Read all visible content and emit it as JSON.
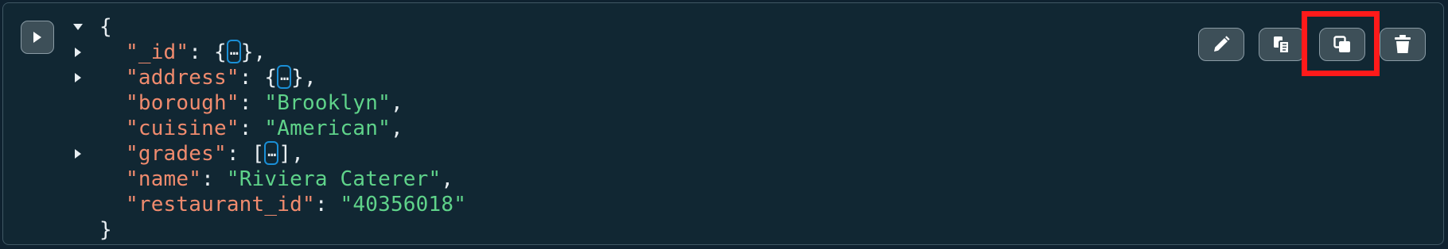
{
  "document": {
    "open_brace": "{",
    "close_brace": "}",
    "ellipsis": "…",
    "fields": [
      {
        "key": "\"_id\"",
        "type": "object"
      },
      {
        "key": "\"address\"",
        "type": "object"
      },
      {
        "key": "\"borough\"",
        "type": "string",
        "value": "\"Brooklyn\""
      },
      {
        "key": "\"cuisine\"",
        "type": "string",
        "value": "\"American\""
      },
      {
        "key": "\"grades\"",
        "type": "array"
      },
      {
        "key": "\"name\"",
        "type": "string",
        "value": "\"Riviera Caterer\""
      },
      {
        "key": "\"restaurant_id\"",
        "type": "string",
        "value": "\"40356018\""
      }
    ]
  },
  "toolbar": {
    "actions": [
      {
        "name": "edit-document-button",
        "icon": "pencil-icon"
      },
      {
        "name": "copy-document-button",
        "icon": "copy-icon"
      },
      {
        "name": "clone-document-button",
        "icon": "clone-icon"
      },
      {
        "name": "delete-document-button",
        "icon": "trash-icon"
      }
    ]
  },
  "colors": {
    "background": "#112733",
    "key": "#f08b6e",
    "string": "#5fd38a",
    "ellipsis_border": "#1a8fd6",
    "highlight": "#ff1a1a"
  }
}
